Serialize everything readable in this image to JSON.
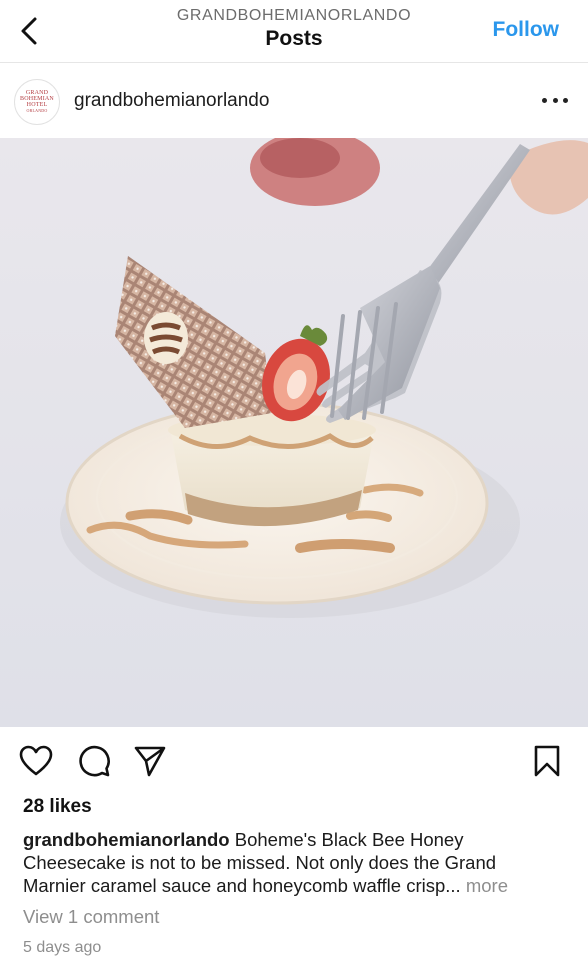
{
  "header": {
    "account_label": "GRANDBOHEMIANORLANDO",
    "title": "Posts",
    "follow_label": "Follow",
    "back_icon": "chevron-left-icon"
  },
  "post": {
    "username": "grandbohemianorlando",
    "avatar_text": [
      "GRAND",
      "BOHEMIAN",
      "HOTEL",
      "ORLANDO"
    ],
    "more_icon": "more-horizontal-icon",
    "photo_icon": "cheesecake-photo"
  },
  "actions": {
    "like_icon": "heart-icon",
    "comment_icon": "comment-icon",
    "share_icon": "send-icon",
    "save_icon": "bookmark-icon"
  },
  "likes": "28 likes",
  "caption": {
    "username": "grandbohemianorlando",
    "line1": "Boheme's Black Bee Honey",
    "line2": "Cheesecake is not to be missed. Not only does the Grand",
    "line3": "Marnier caramel sauce and honeycomb waffle crisp...",
    "more_label": "more"
  },
  "comments_link": "View 1 comment",
  "timestamp": "5 days ago",
  "colors": {
    "accent": "#2b97ec",
    "secondary_text": "#8e8e8e",
    "avatar_brand": "#b33a3f"
  }
}
